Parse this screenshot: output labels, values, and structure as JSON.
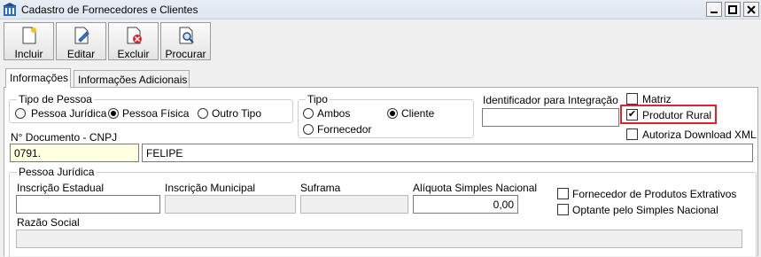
{
  "window": {
    "title": "Cadastro de Fornecedores e Clientes"
  },
  "toolbar": {
    "items": [
      {
        "label": "Incluir",
        "icon": "new-document-icon"
      },
      {
        "label": "Editar",
        "icon": "edit-document-icon"
      },
      {
        "label": "Excluir",
        "icon": "delete-document-icon"
      },
      {
        "label": "Procurar",
        "icon": "search-document-icon"
      }
    ]
  },
  "tabs": [
    {
      "label": "Informações",
      "active": true
    },
    {
      "label": "Informações Adicionais",
      "active": false
    }
  ],
  "tipo_pessoa": {
    "title": "Tipo de Pessoa",
    "options": [
      "Pessoa Jurídica",
      "Pessoa Física",
      "Outro Tipo"
    ],
    "selected": "Pessoa Física"
  },
  "tipo": {
    "title": "Tipo",
    "options": [
      "Ambos",
      "Cliente",
      "Fornecedor"
    ],
    "selected": "Cliente"
  },
  "identificador": {
    "label": "Identificador para Integração",
    "value": ""
  },
  "flags": {
    "matriz": {
      "label": "Matriz",
      "checked": false
    },
    "produtor_rural": {
      "label": "Produtor Rural",
      "checked": true
    },
    "autoriza_download": {
      "label": "Autoriza Download XML",
      "checked": false
    }
  },
  "documento": {
    "label": "N° Documento - CNPJ",
    "value": "0791.",
    "name_value": "FELIPE"
  },
  "pessoa_juridica": {
    "title": "Pessoa Jurídica",
    "inscricao_estadual": {
      "label": "Inscrição Estadual",
      "value": ""
    },
    "inscricao_municipal": {
      "label": "Inscrição Municipal",
      "value": ""
    },
    "suframa": {
      "label": "Suframa",
      "value": ""
    },
    "aliquota": {
      "label": "Alíquota Simples Nacional",
      "value": "0,00"
    },
    "fornecedor_extrativos": {
      "label": "Fornecedor de Produtos Extrativos",
      "checked": false
    },
    "optante_simples": {
      "label": "Optante pelo Simples Nacional",
      "checked": false
    },
    "razao_social": {
      "label": "Razão Social",
      "value": ""
    }
  },
  "colors": {
    "highlight": "#d9262c",
    "titlebar": "#e9eef5",
    "yellow_field": "#ffffe1"
  }
}
